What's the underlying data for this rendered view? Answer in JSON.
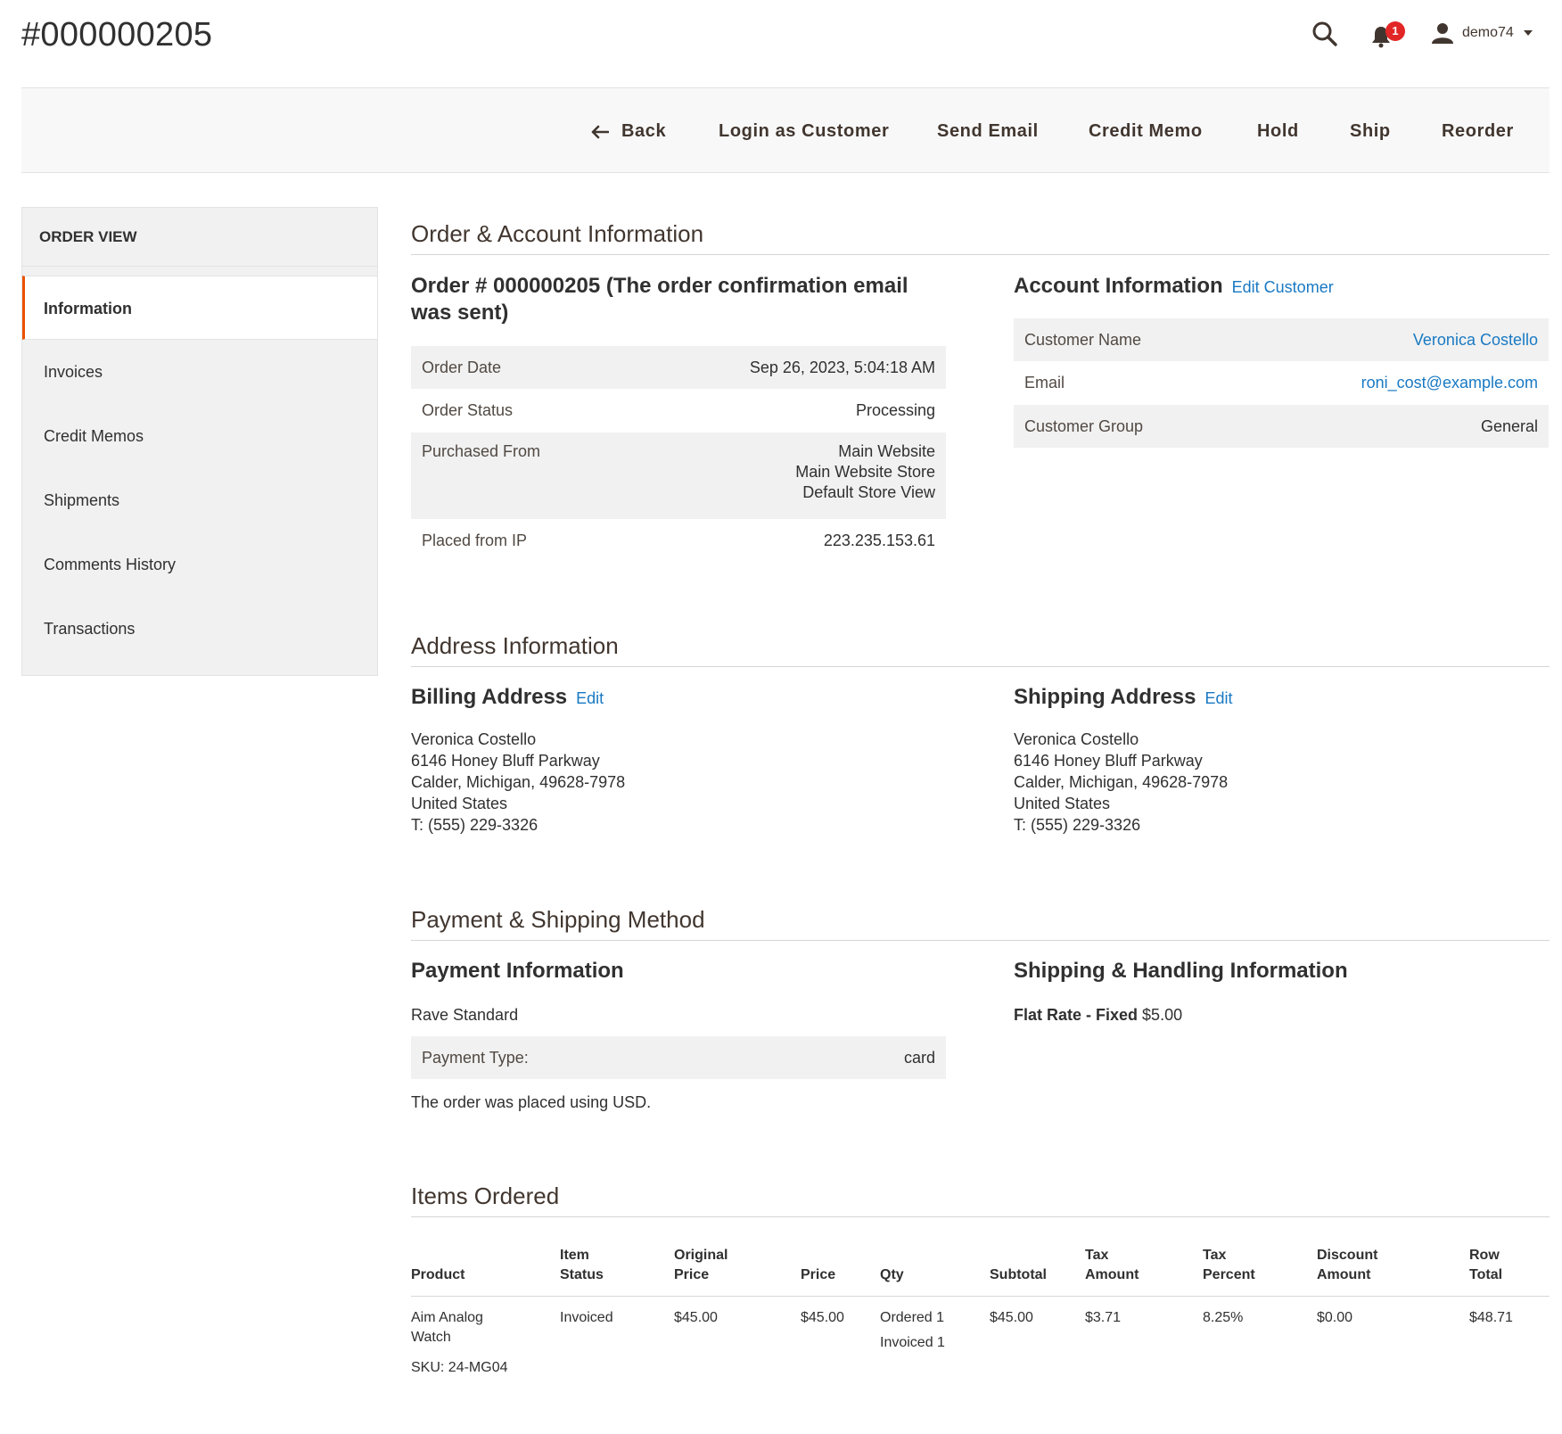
{
  "header": {
    "title": "#000000205",
    "notification_count": "1",
    "username": "demo74"
  },
  "actions": {
    "back": "Back",
    "login_as_customer": "Login as Customer",
    "send_email": "Send Email",
    "credit_memo": "Credit Memo",
    "hold": "Hold",
    "ship": "Ship",
    "reorder": "Reorder"
  },
  "sidebar": {
    "title": "ORDER VIEW",
    "items": [
      {
        "label": "Information"
      },
      {
        "label": "Invoices"
      },
      {
        "label": "Credit Memos"
      },
      {
        "label": "Shipments"
      },
      {
        "label": "Comments History"
      },
      {
        "label": "Transactions"
      }
    ]
  },
  "order_account": {
    "section_title": "Order & Account Information",
    "order_heading": "Order # 000000205 (The order confirmation email was sent)",
    "order_rows": {
      "date_label": "Order Date",
      "date_value": "Sep 26, 2023, 5:04:18 AM",
      "status_label": "Order Status",
      "status_value": "Processing",
      "purchased_label": "Purchased From",
      "purchased_line1": "Main Website",
      "purchased_line2": "Main Website Store",
      "purchased_line3": "Default Store View",
      "ip_label": "Placed from IP",
      "ip_value": "223.235.153.61"
    },
    "account_heading": "Account Information",
    "account_edit": "Edit Customer",
    "account_rows": {
      "name_label": "Customer Name",
      "name_value": "Veronica Costello",
      "email_label": "Email",
      "email_value": "roni_cost@example.com",
      "group_label": "Customer Group",
      "group_value": "General"
    }
  },
  "address": {
    "section_title": "Address Information",
    "billing_heading": "Billing Address",
    "shipping_heading": "Shipping Address",
    "edit_label": "Edit",
    "billing": {
      "name": "Veronica Costello",
      "street": "6146 Honey Bluff Parkway",
      "city": "Calder, Michigan, 49628-7978",
      "country": "United States",
      "phone": "T: (555) 229-3326"
    },
    "shipping": {
      "name": "Veronica Costello",
      "street": "6146 Honey Bluff Parkway",
      "city": "Calder, Michigan, 49628-7978",
      "country": "United States",
      "phone": "T: (555) 229-3326"
    }
  },
  "payment_shipping": {
    "section_title": "Payment & Shipping Method",
    "payment_heading": "Payment Information",
    "payment_method": "Rave Standard",
    "payment_type_label": "Payment Type:",
    "payment_type_value": "card",
    "currency_note": "The order was placed using USD.",
    "shipping_heading": "Shipping & Handling Information",
    "shipping_method_bold": "Flat Rate - Fixed",
    "shipping_method_price": "$5.00"
  },
  "items": {
    "section_title": "Items Ordered",
    "columns": {
      "product": "Product",
      "item_status_1": "Item",
      "item_status_2": "Status",
      "original_price_1": "Original",
      "original_price_2": "Price",
      "price": "Price",
      "qty": "Qty",
      "subtotal": "Subtotal",
      "tax_amount_1": "Tax",
      "tax_amount_2": "Amount",
      "tax_percent_1": "Tax",
      "tax_percent_2": "Percent",
      "discount_1": "Discount",
      "discount_2": "Amount",
      "row_total_1": "Row",
      "row_total_2": "Total"
    },
    "rows": [
      {
        "product_line1": "Aim Analog",
        "product_line2": "Watch",
        "sku": "SKU: 24-MG04",
        "status": "Invoiced",
        "original_price": "$45.00",
        "price": "$45.00",
        "qty_ordered": "Ordered 1",
        "qty_invoiced": "Invoiced 1",
        "subtotal": "$45.00",
        "tax_amount": "$3.71",
        "tax_percent": "8.25%",
        "discount": "$0.00",
        "row_total": "$48.71"
      }
    ]
  }
}
